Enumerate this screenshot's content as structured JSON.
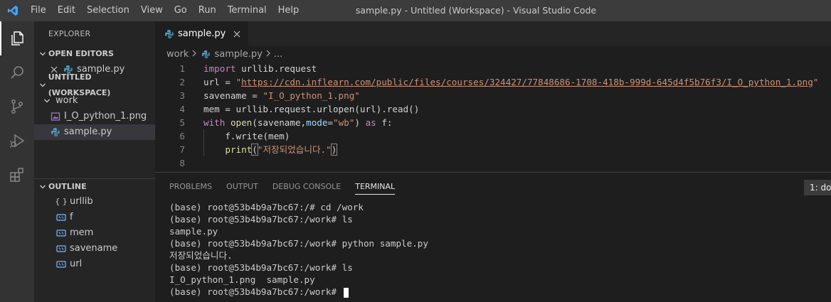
{
  "titlebar": {
    "menu": [
      "File",
      "Edit",
      "Selection",
      "View",
      "Go",
      "Run",
      "Terminal",
      "Help"
    ],
    "title": "sample.py - Untitled (Workspace) - Visual Studio Code"
  },
  "activity": [
    "files-icon",
    "search-icon",
    "source-control-icon",
    "run-debug-icon",
    "extensions-icon"
  ],
  "sidebar": {
    "title": "EXPLORER",
    "open_editors": {
      "heading": "OPEN EDITORS",
      "items": [
        {
          "name": "sample.py"
        }
      ]
    },
    "workspace": {
      "heading": "UNTITLED (WORKSPACE)",
      "folder": "work",
      "files": [
        "I_O_python_1.png",
        "sample.py"
      ]
    },
    "outline": {
      "heading": "OUTLINE",
      "items": [
        {
          "symbol": "{ }",
          "name": "urllib"
        },
        {
          "symbol": "var",
          "name": "f"
        },
        {
          "symbol": "var",
          "name": "mem"
        },
        {
          "symbol": "var",
          "name": "savename"
        },
        {
          "symbol": "var",
          "name": "url"
        }
      ]
    }
  },
  "editor": {
    "tab_label": "sample.py",
    "breadcrumb": {
      "folder": "work",
      "file": "sample.py",
      "more": "..."
    },
    "lines": [
      {
        "n": "1",
        "parts": [
          [
            "kw",
            "import"
          ],
          [
            "",
            " urllib.request"
          ]
        ]
      },
      {
        "n": "2",
        "parts": [
          [
            "",
            "url = "
          ],
          [
            "str",
            "\""
          ],
          [
            "url",
            "https://cdn.inflearn.com/public/files/courses/324427/77848686-1708-418b-999d-645d4f5b76f3/I_O_python_1.png"
          ],
          [
            "str",
            "\""
          ]
        ]
      },
      {
        "n": "3",
        "parts": [
          [
            "",
            "savename = "
          ],
          [
            "str",
            "\"I_O_python_1.png\""
          ]
        ]
      },
      {
        "n": "4",
        "parts": [
          [
            "",
            "mem = urllib.request.urlopen(url).read()"
          ]
        ]
      },
      {
        "n": "5",
        "parts": [
          [
            "kw",
            "with"
          ],
          [
            "",
            " "
          ],
          [
            "fn",
            "open"
          ],
          [
            "",
            "(savename,"
          ],
          [
            "param",
            "mode"
          ],
          [
            "",
            "="
          ],
          [
            "str",
            "\"wb\""
          ],
          [
            "",
            ") "
          ],
          [
            "kw",
            "as"
          ],
          [
            "",
            " f:"
          ]
        ]
      },
      {
        "n": "6",
        "parts": [
          [
            "",
            "    f.write(mem)"
          ]
        ]
      },
      {
        "n": "7",
        "parts": [
          [
            "",
            "    "
          ],
          [
            "fn",
            "print"
          ],
          [
            "br",
            "("
          ],
          [
            "str",
            "\"저장되었습니다.\""
          ],
          [
            "br",
            ")"
          ]
        ]
      },
      {
        "n": "8",
        "parts": []
      }
    ]
  },
  "panel": {
    "tabs": [
      "PROBLEMS",
      "OUTPUT",
      "DEBUG CONSOLE",
      "TERMINAL"
    ],
    "active_tab": "TERMINAL",
    "terminal_select": "1: do",
    "terminal_lines": [
      "(base) root@53b4b9a7bc67:/# cd /work",
      "(base) root@53b4b9a7bc67:/work# ls",
      "sample.py",
      "(base) root@53b4b9a7bc67:/work# python sample.py",
      "저장되었습니다.",
      "(base) root@53b4b9a7bc67:/work# ls",
      "I_O_python_1.png  sample.py",
      "(base) root@53b4b9a7bc67:/work# "
    ]
  },
  "colors": {
    "titlebar": "#3c3c3c",
    "activitybar": "#333333",
    "sidebar": "#252526",
    "editor": "#1e1e1e",
    "keyword": "#c586c0",
    "string": "#ce9178",
    "function": "#dcdcaa",
    "python_icon": "#519aba",
    "symbol_icon": "#75beff"
  }
}
